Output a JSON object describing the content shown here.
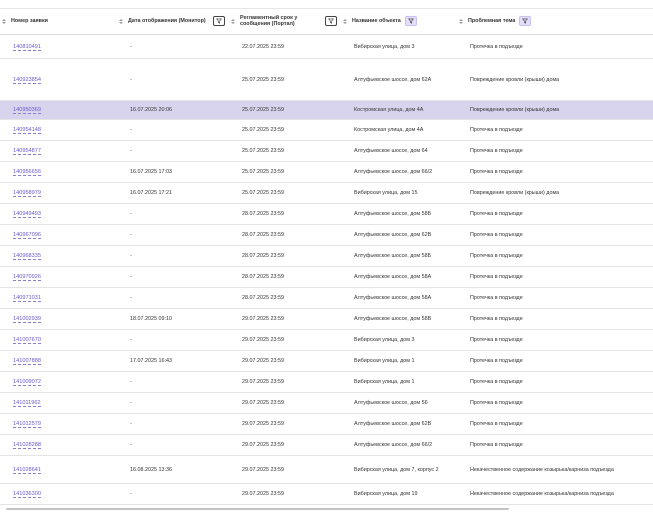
{
  "columns": [
    {
      "label": "Номер заявки",
      "filter": "none"
    },
    {
      "label": "Дата отображения (Монитор)",
      "filter": "plain"
    },
    {
      "label": "Регламентный срок у сообщения (Портал)",
      "filter": "plain"
    },
    {
      "label": "Название объекта",
      "filter": "purple"
    },
    {
      "label": "Проблемная тема",
      "filter": "purple"
    }
  ],
  "colors": {
    "accent": "#6a5acd",
    "selected_row": "#d9d4ee",
    "filter_active": "#e4def8"
  },
  "rows": [
    {
      "id": "140810491",
      "monitor_date": "-",
      "deadline": "22.07.2025 23:59",
      "object": "Вибирская улица, дом 3",
      "topic": "Протечка в подъезде",
      "h": 24
    },
    {
      "id": "140923854",
      "monitor_date": "-",
      "deadline": "25.07.2025 23:59",
      "object": "Алтуфьевское шоссе, дом 62А",
      "topic": "Повреждение кровли (крыши) дома",
      "h": 42
    },
    {
      "id": "140950369",
      "monitor_date": "16.07.2025 20:06",
      "deadline": "25.07.2025 23:59",
      "object": "Костромская улица, дом 4А",
      "topic": "Повреждение кровли (крыши) дома",
      "h": 19,
      "selected": true
    },
    {
      "id": "140954148",
      "monitor_date": "-",
      "deadline": "25.07.2025 23:59",
      "object": "Костромская улица, дом 4А",
      "topic": "Протечка в подъезде",
      "h": 21
    },
    {
      "id": "140954877",
      "monitor_date": "-",
      "deadline": "25.07.2025 23:59",
      "object": "Алтуфьевское шоссе, дом 64",
      "topic": "Протечка в подъезде",
      "h": 21
    },
    {
      "id": "140956656",
      "monitor_date": "16.07.2025 17:03",
      "deadline": "25.07.2025 23:59",
      "object": "Алтуфьевское шоссе, дом 66/2",
      "topic": "Протечка в подъезде",
      "h": 21
    },
    {
      "id": "140958979",
      "monitor_date": "16.07.2025 17:21",
      "deadline": "25.07.2025 23:59",
      "object": "Вибирская улица, дом 15",
      "topic": "Повреждение кровли (крыши) дома",
      "h": 21
    },
    {
      "id": "140949493",
      "monitor_date": "-",
      "deadline": "28.07.2025 23:59",
      "object": "Алтуфьевское шоссе, дом 58Б",
      "topic": "Протечка в подъезде",
      "h": 21
    },
    {
      "id": "140967096",
      "monitor_date": "-",
      "deadline": "28.07.2025 23:59",
      "object": "Алтуфьевское шоссе, дом 62В",
      "topic": "Протечка в подъезде",
      "h": 21
    },
    {
      "id": "140968335",
      "monitor_date": "-",
      "deadline": "28.07.2025 23:59",
      "object": "Алтуфьевское шоссе, дом 58Б",
      "topic": "Протечка в подъезде",
      "h": 21
    },
    {
      "id": "140970926",
      "monitor_date": "-",
      "deadline": "28.07.2025 23:59",
      "object": "Алтуфьевское шоссе, дом 58А",
      "topic": "Протечка в подъезде",
      "h": 21
    },
    {
      "id": "140971031",
      "monitor_date": "-",
      "deadline": "28.07.2025 23:59",
      "object": "Алтуфьевское шоссе, дом 58А",
      "topic": "Протечка в подъезде",
      "h": 21
    },
    {
      "id": "141002939",
      "monitor_date": "18.07.2025 09:10",
      "deadline": "29.07.2025 23:59",
      "object": "Алтуфьевское шоссе, дом 58В",
      "topic": "Протечка в подъезде",
      "h": 21
    },
    {
      "id": "141007670",
      "monitor_date": "-",
      "deadline": "29.07.2025 23:59",
      "object": "Вибирская улица, дом 3",
      "topic": "Протечка в подъезде",
      "h": 21
    },
    {
      "id": "141007888",
      "monitor_date": "17.07.2025 16:43",
      "deadline": "29.07.2025 23:59",
      "object": "Вибирская улица, дом 1",
      "topic": "Протечка в подъезде",
      "h": 21
    },
    {
      "id": "141009072",
      "monitor_date": "-",
      "deadline": "29.07.2025 23:59",
      "object": "Вибирская улица, дом 1",
      "topic": "Протечка в подъезде",
      "h": 21
    },
    {
      "id": "141011962",
      "monitor_date": "-",
      "deadline": "29.07.2025 23:59",
      "object": "Алтуфьевское шоссе, дом 56",
      "topic": "Протечка в подъезде",
      "h": 21
    },
    {
      "id": "141012579",
      "monitor_date": "-",
      "deadline": "29.07.2025 23:59",
      "object": "Алтуфьевское шоссе, дом 62В",
      "topic": "Протечка в подъезде",
      "h": 21
    },
    {
      "id": "141028288",
      "monitor_date": "-",
      "deadline": "29.07.2025 23:59",
      "object": "Алтуфьевское шоссе, дом 66/2",
      "topic": "Протечка в подъезде",
      "h": 21
    },
    {
      "id": "141028641",
      "monitor_date": "16.08.2025 13:36",
      "deadline": "29.07.2025 23:59",
      "object": "Вибирская улица, дом 7, корпус 2",
      "topic": "Некачественное содержание козырька/карниза подъезда",
      "h": 28
    },
    {
      "id": "141036300",
      "monitor_date": "-",
      "deadline": "29.07.2025 23:59",
      "object": "Вибирская улица, дом 19",
      "topic": "Некачественное содержание козырька/карниза подъезда",
      "h": 21
    }
  ]
}
